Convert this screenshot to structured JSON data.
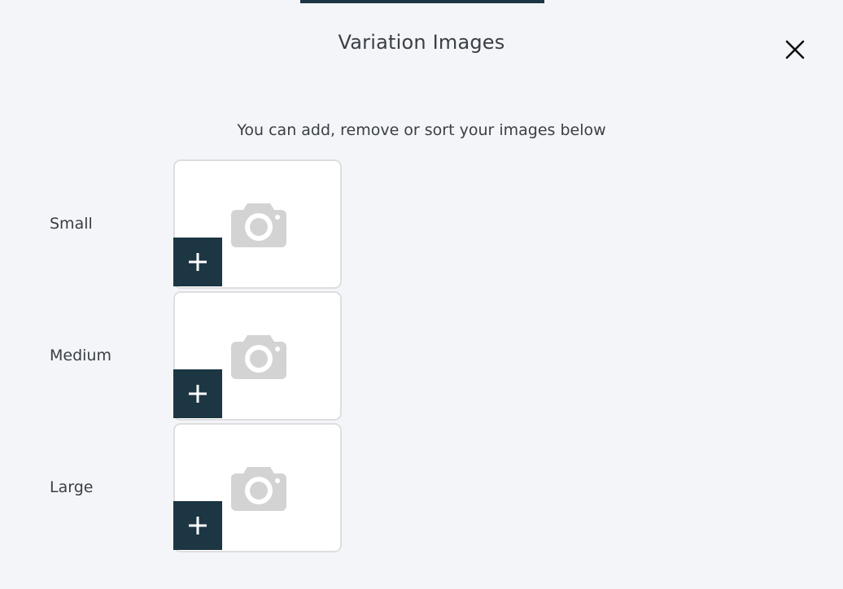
{
  "modal": {
    "title": "Variation Images",
    "subtitle": "You can add, remove or sort your images below",
    "close_icon": "close-icon"
  },
  "rows": [
    {
      "label": "Small",
      "placeholder_icon": "camera-icon",
      "add_icon": "plus-icon"
    },
    {
      "label": "Medium",
      "placeholder_icon": "camera-icon",
      "add_icon": "plus-icon"
    },
    {
      "label": "Large",
      "placeholder_icon": "camera-icon",
      "add_icon": "plus-icon"
    }
  ],
  "colors": {
    "background": "#f3f5f9",
    "accent": "#1c3643",
    "placeholder_icon": "#d3d3d3",
    "slot_border": "#dedede",
    "text": "#3a3f45"
  }
}
